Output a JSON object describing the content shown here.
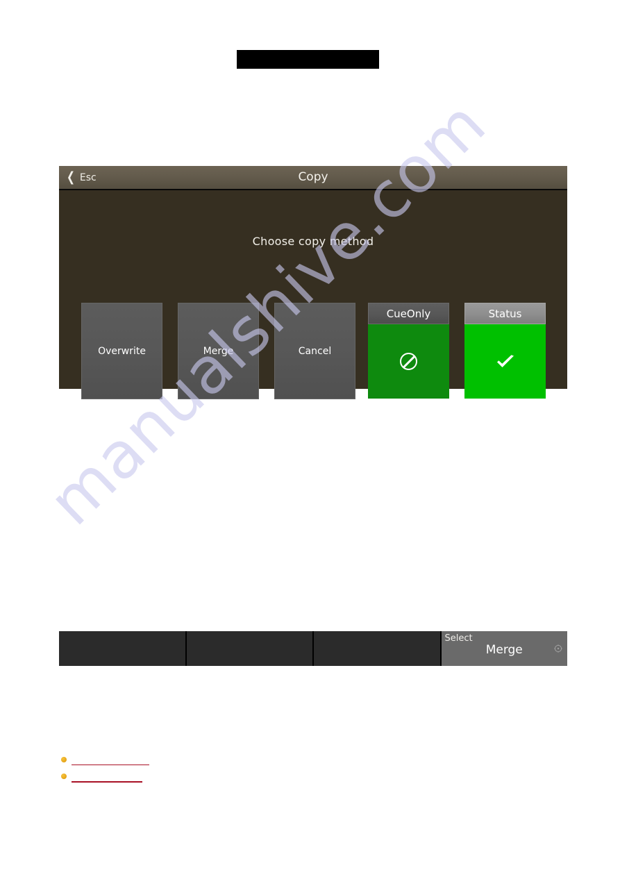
{
  "page": {
    "watermark": "manualshive.com"
  },
  "redaction": {
    "top_bar": ""
  },
  "screen": {
    "title_bar": {
      "back_label": "Esc",
      "back_icon": "chevron-left-icon",
      "title": "Copy"
    },
    "prompt": "Choose copy method",
    "choices": [
      {
        "label": "Overwrite"
      },
      {
        "label": "Merge"
      },
      {
        "label": "Cancel"
      }
    ],
    "toggles": [
      {
        "label": "CueOnly",
        "state": "off",
        "icon": "prohibited-icon",
        "header_style": "dark",
        "body_color": "#0e8a0e"
      },
      {
        "label": "Status",
        "state": "on",
        "icon": "check-icon",
        "header_style": "light",
        "body_color": "#00c000"
      }
    ]
  },
  "encoder_bar": {
    "cells": [
      {
        "label": "",
        "value": "",
        "active": false
      },
      {
        "label": "",
        "value": "",
        "active": false
      },
      {
        "label": "",
        "value": "",
        "active": false
      },
      {
        "label": "Select",
        "value": "Merge",
        "active": true,
        "icon": "encoder-knob-icon"
      }
    ]
  },
  "bullets": [
    {
      "text": ""
    },
    {
      "text": ""
    }
  ],
  "colors": {
    "panel_bg": "#362f21",
    "title_bar": "#635b4c",
    "choice_button": "#575757",
    "toggle_off_green": "#0e8a0e",
    "toggle_on_green": "#00c000",
    "encoder_active": "#6a6a6a",
    "bullet_dot": "#e8a81c",
    "link_underline": "#a81025"
  }
}
